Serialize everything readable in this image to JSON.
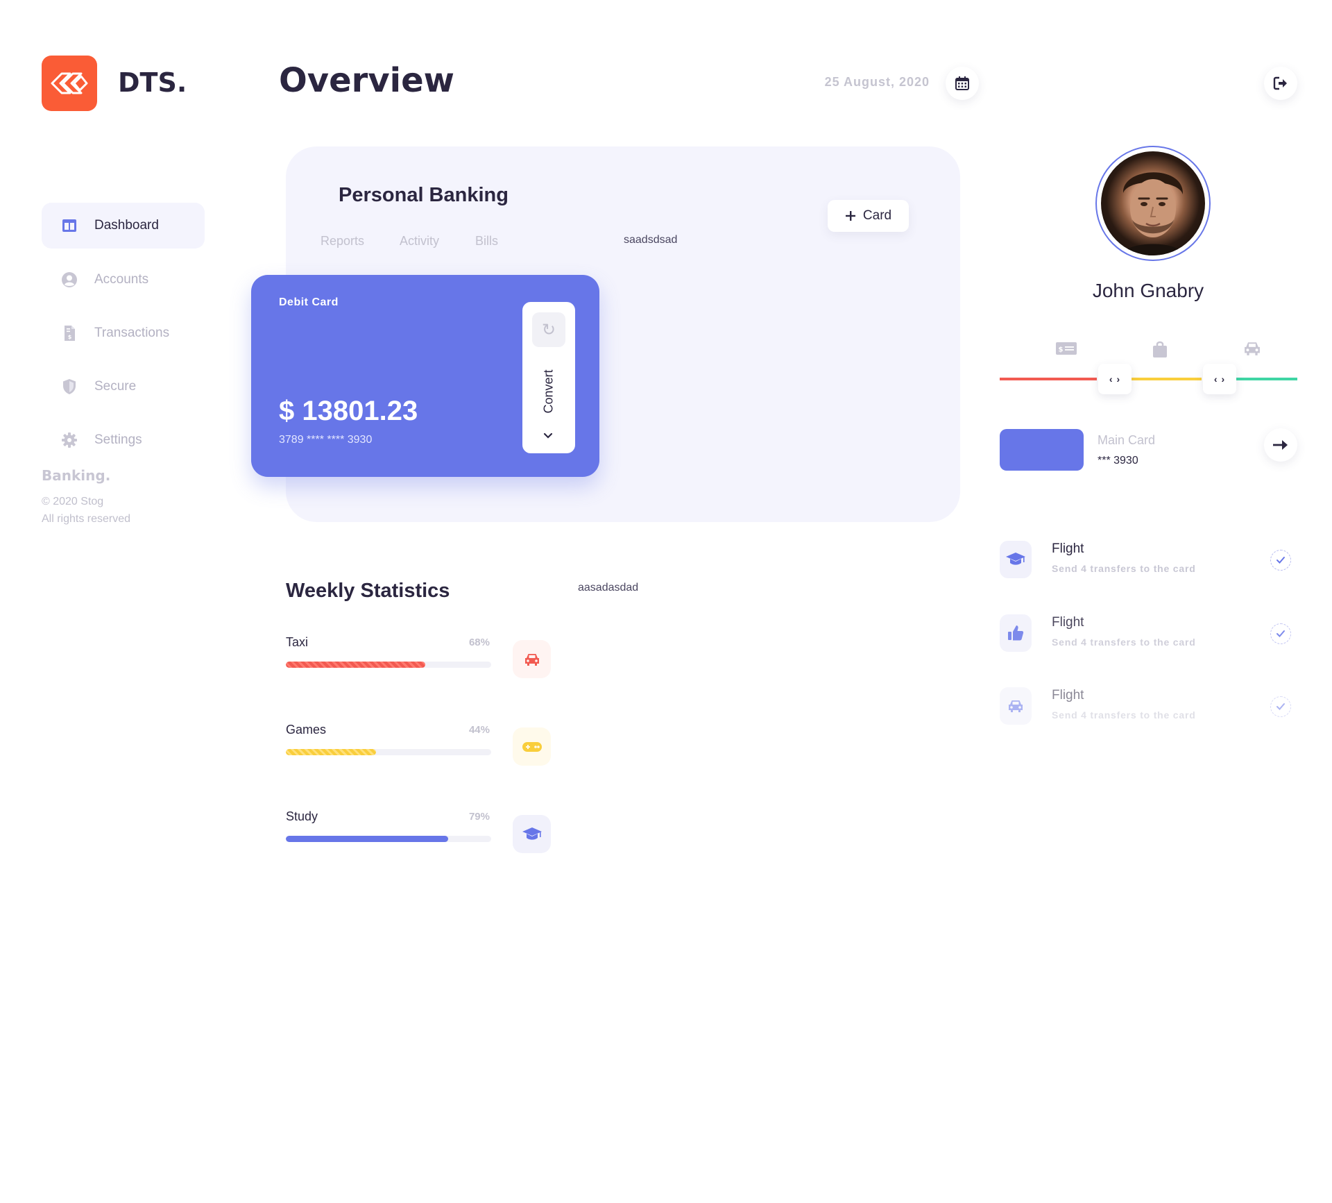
{
  "brand": {
    "name": "DTS.",
    "logo_color": "#fa5c36"
  },
  "sidebar": {
    "items": [
      {
        "label": "Dashboard",
        "icon": "columns-icon",
        "active": true
      },
      {
        "label": "Accounts",
        "icon": "user-circle-icon",
        "active": false
      },
      {
        "label": "Transactions",
        "icon": "invoice-icon",
        "active": false
      },
      {
        "label": "Secure",
        "icon": "shield-icon",
        "active": false
      },
      {
        "label": "Settings",
        "icon": "gear-icon",
        "active": false
      }
    ],
    "footer": {
      "brand": "Banking.",
      "copyright": "© 2020 Stog",
      "rights": "All rights reserved"
    }
  },
  "header": {
    "title": "Overview",
    "date": "25 August, 2020"
  },
  "banking": {
    "title": "Personal Banking",
    "tabs": [
      "Reports",
      "Activity",
      "Bills"
    ],
    "misc_text": "saadsdsad",
    "add_button": "Card",
    "card": {
      "label": "Debit Card",
      "amount": "$ 13801.23",
      "number": "3789 **** **** 3930",
      "convert_label": "Convert",
      "color": "#6776e8"
    }
  },
  "weekly": {
    "title": "Weekly Statistics",
    "misc_text": "aasadasdad",
    "stats": [
      {
        "label": "Taxi",
        "percent_text": "68%",
        "percent": 68,
        "color": "#f25a51",
        "icon": "car-icon"
      },
      {
        "label": "Games",
        "percent_text": "44%",
        "percent": 44,
        "color": "#f9ce3c",
        "icon": "gamepad-icon"
      },
      {
        "label": "Study",
        "percent_text": "79%",
        "percent": 79,
        "color": "#6776e8",
        "icon": "graduation-cap-icon"
      }
    ]
  },
  "profile": {
    "name": "John Gnabry",
    "categories": [
      "money-bill-icon",
      "shopping-bag-icon",
      "car-icon"
    ],
    "range_colors": [
      "#f25a51",
      "#f9ce3c",
      "#3fd5a4"
    ],
    "knob_label": "‹ ›",
    "main_card": {
      "label": "Main Card",
      "number": "*** 3930"
    }
  },
  "transactions": [
    {
      "title": "Flight",
      "subtitle": "Send 4 transfers to the card",
      "icon": "graduation-cap-icon"
    },
    {
      "title": "Flight",
      "subtitle": "Send 4 transfers to the card",
      "icon": "thumbs-up-icon"
    },
    {
      "title": "Flight",
      "subtitle": "Send 4 transfers to the card",
      "icon": "car-icon"
    }
  ]
}
